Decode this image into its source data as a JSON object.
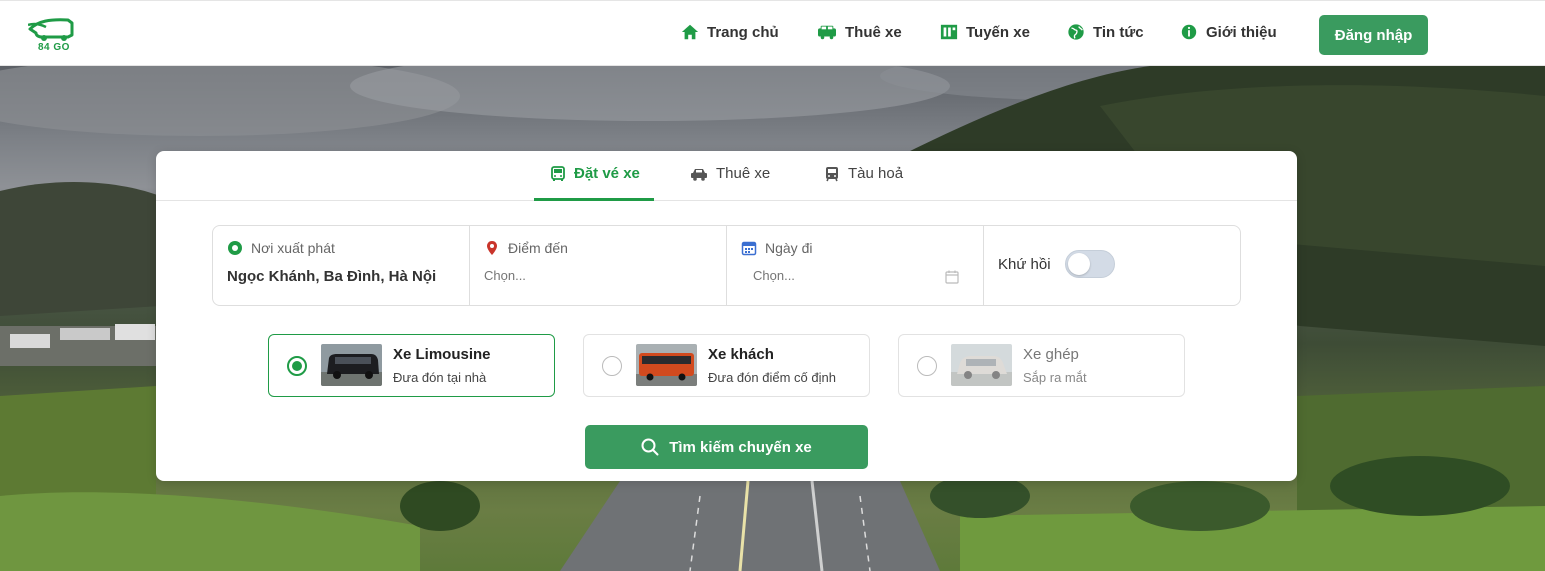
{
  "brand": {
    "logo_text": "84 GO",
    "accent": "#1f9b46",
    "button_color": "#3a9b5f"
  },
  "nav": {
    "items": [
      {
        "label": "Trang chủ",
        "icon": "home-icon"
      },
      {
        "label": "Thuê xe",
        "icon": "car-icon"
      },
      {
        "label": "Tuyến xe",
        "icon": "map-icon"
      },
      {
        "label": "Tin tức",
        "icon": "globe-icon"
      },
      {
        "label": "Giới thiệu",
        "icon": "info-icon"
      }
    ],
    "login_label": "Đăng nhập"
  },
  "search": {
    "tabs": [
      {
        "label": "Đặt vé xe",
        "icon": "bus-icon",
        "active": true
      },
      {
        "label": "Thuê xe",
        "icon": "car-icon",
        "active": false
      },
      {
        "label": "Tàu hoả",
        "icon": "train-icon",
        "active": false
      }
    ],
    "origin": {
      "label": "Nơi xuất phát",
      "value": "Ngọc Khánh, Ba Đình, Hà Nội"
    },
    "destination": {
      "label": "Điểm đến",
      "placeholder": "Chọn..."
    },
    "date": {
      "label": "Ngày đi",
      "placeholder": "Chọn..."
    },
    "round_trip": {
      "label": "Khứ hồi",
      "on": false
    },
    "vehicle_types": [
      {
        "name": "Xe Limousine",
        "desc": "Đưa đón tại nhà",
        "selected": true,
        "disabled": false
      },
      {
        "name": "Xe khách",
        "desc": "Đưa đón điểm cố định",
        "selected": false,
        "disabled": false
      },
      {
        "name": "Xe ghép",
        "desc": "Sắp ra mắt",
        "selected": false,
        "disabled": true
      }
    ],
    "submit_label": "Tìm kiếm chuyến xe"
  }
}
